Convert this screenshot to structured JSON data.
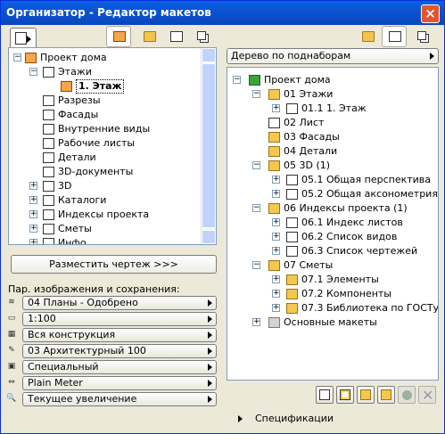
{
  "window": {
    "title": "Организатор - Редактор макетов",
    "close_glyph": "×"
  },
  "left": {
    "tree": [
      {
        "label": "Проект дома",
        "icon": "project-house-icon",
        "exp": "−"
      },
      {
        "label": "Этажи",
        "icon": "stories-icon",
        "exp": "−"
      },
      {
        "label": "1. Этаж",
        "icon": "story-icon",
        "exp": ""
      },
      {
        "label": "Разрезы",
        "icon": "section-icon",
        "exp": ""
      },
      {
        "label": "Фасады",
        "icon": "elevation-icon",
        "exp": ""
      },
      {
        "label": "Внутренние виды",
        "icon": "interior-elevation-icon",
        "exp": ""
      },
      {
        "label": "Рабочие листы",
        "icon": "worksheet-icon",
        "exp": ""
      },
      {
        "label": "Детали",
        "icon": "detail-icon",
        "exp": ""
      },
      {
        "label": "3D-документы",
        "icon": "3d-document-icon",
        "exp": ""
      },
      {
        "label": "3D",
        "icon": "3d-icon",
        "exp": "+"
      },
      {
        "label": "Каталоги",
        "icon": "schedule-icon",
        "exp": "+"
      },
      {
        "label": "Индексы проекта",
        "icon": "project-index-icon",
        "exp": "+"
      },
      {
        "label": "Сметы",
        "icon": "list-icon",
        "exp": "+"
      },
      {
        "label": "Инфо",
        "icon": "info-icon",
        "exp": "+"
      }
    ],
    "place_button": "Разместить чертеж >>>",
    "params_label": "Пар. изображения и сохранения:",
    "combos": [
      {
        "value": "04 Планы - Одобрено",
        "icon": "layer-combination-icon"
      },
      {
        "value": "1:100",
        "icon": "scale-icon"
      },
      {
        "value": "Вся конструкция",
        "icon": "structure-display-icon"
      },
      {
        "value": "03 Архитектурный 100",
        "icon": "pen-set-icon"
      },
      {
        "value": "Специальный",
        "icon": "model-view-icon"
      },
      {
        "value": "Plain Meter",
        "icon": "dimension-icon"
      },
      {
        "value": "Текущее увеличение",
        "icon": "zoom-icon"
      }
    ]
  },
  "right": {
    "dropdown": "Дерево по поднаборам",
    "tree": [
      {
        "label": "Проект дома",
        "icon": "layout-book-icon",
        "exp": "−",
        "lvl": 0
      },
      {
        "label": "01 Этажи",
        "icon": "subset-icon",
        "exp": "−",
        "lvl": 1
      },
      {
        "label": "01.1 1. Этаж",
        "icon": "layout-icon",
        "exp": "+",
        "lvl": 2
      },
      {
        "label": "02 Лист",
        "icon": "layout-icon",
        "exp": "",
        "lvl": 1
      },
      {
        "label": "03 Фасады",
        "icon": "subset-icon",
        "exp": "",
        "lvl": 1
      },
      {
        "label": "04 Детали",
        "icon": "subset-icon",
        "exp": "",
        "lvl": 1
      },
      {
        "label": "05 3D (1)",
        "icon": "subset-icon",
        "exp": "−",
        "lvl": 1
      },
      {
        "label": "05.1 Общая перспектива",
        "icon": "layout-icon",
        "exp": "+",
        "lvl": 2
      },
      {
        "label": "05.2 Общая аксонометрия",
        "icon": "layout-icon",
        "exp": "+",
        "lvl": 2
      },
      {
        "label": "06 Индексы проекта (1)",
        "icon": "subset-icon",
        "exp": "−",
        "lvl": 1
      },
      {
        "label": "06.1 Индекс листов",
        "icon": "layout-icon",
        "exp": "+",
        "lvl": 2
      },
      {
        "label": "06.2 Список видов",
        "icon": "layout-icon",
        "exp": "+",
        "lvl": 2
      },
      {
        "label": "06.3 Список чертежей",
        "icon": "layout-icon",
        "exp": "+",
        "lvl": 2
      },
      {
        "label": "07 Сметы",
        "icon": "subset-icon",
        "exp": "−",
        "lvl": 1
      },
      {
        "label": "07.1 Элементы",
        "icon": "subset-icon",
        "exp": "+",
        "lvl": 2
      },
      {
        "label": "07.2 Компоненты",
        "icon": "subset-icon",
        "exp": "+",
        "lvl": 2
      },
      {
        "label": "07.3 Библиотека по ГОСТу",
        "icon": "subset-icon",
        "exp": "+",
        "lvl": 2
      },
      {
        "label": "Основные макеты",
        "icon": "master-layouts-icon",
        "exp": "+",
        "lvl": 1
      }
    ],
    "specs_label": "Спецификации"
  }
}
